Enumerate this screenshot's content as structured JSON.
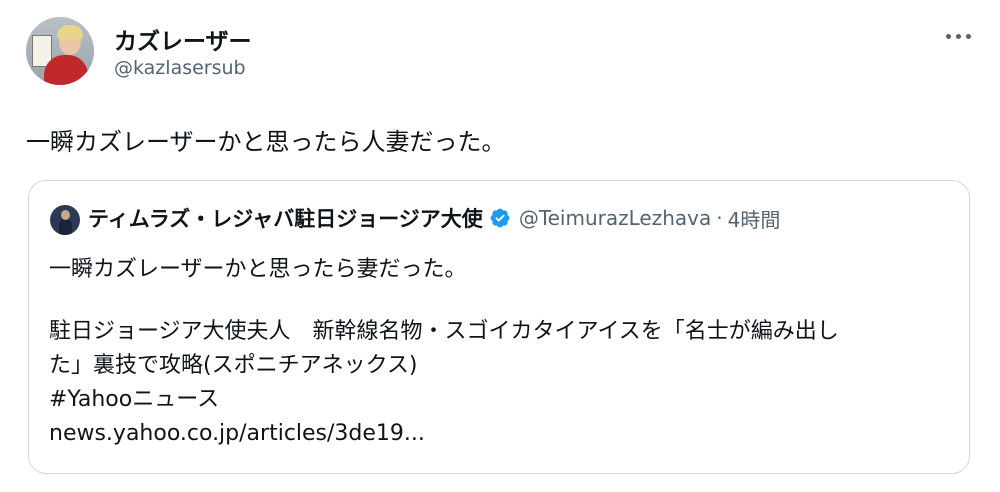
{
  "author": {
    "display_name": "カズレーザー",
    "handle": "@kazlasersub"
  },
  "menu_icon": "more-horizontal-icon",
  "tweet_text": "一瞬カズレーザーかと思ったら人妻だった。",
  "quoted": {
    "display_name": "ティムラズ・レジャバ駐日ジョージア大使",
    "verified_icon": "verified-badge-icon",
    "verified_color": "#1d9bf0",
    "handle": "@TeimurazLezhava",
    "separator": "·",
    "time": "4時間",
    "text": "一瞬カズレーザーかと思ったら妻だった。",
    "article_lines": [
      "駐日ジョージア大使夫人　新幹線名物・スゴイカタイアイスを「名士が編み出し",
      "た」裏技で攻略(スポニチアネックス)",
      "#Yahooニュース",
      "news.yahoo.co.jp/articles/3de19..."
    ]
  },
  "colors": {
    "text_primary": "#0f1419",
    "text_secondary": "#536471",
    "border": "#cfd9de"
  }
}
